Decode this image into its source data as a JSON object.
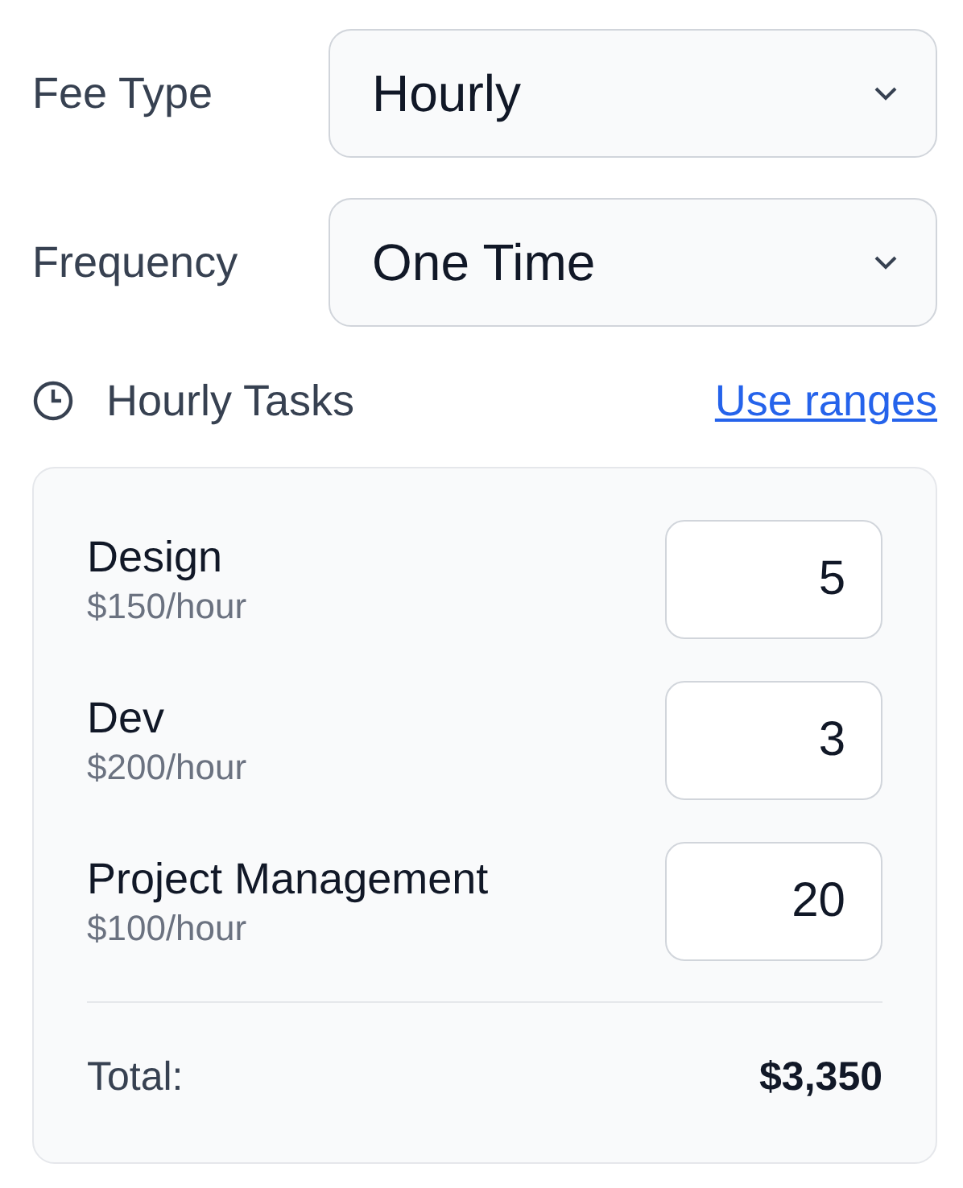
{
  "fields": [
    {
      "label": "Fee Type",
      "value": "Hourly"
    },
    {
      "label": "Frequency",
      "value": "One Time"
    }
  ],
  "section": {
    "title": "Hourly Tasks",
    "link": "Use ranges"
  },
  "tasks": [
    {
      "name": "Design",
      "rate": "$150/hour",
      "hours": "5"
    },
    {
      "name": "Dev",
      "rate": "$200/hour",
      "hours": "3"
    },
    {
      "name": "Project Management",
      "rate": "$100/hour",
      "hours": "20"
    }
  ],
  "total": {
    "label": "Total:",
    "value": "$3,350"
  }
}
